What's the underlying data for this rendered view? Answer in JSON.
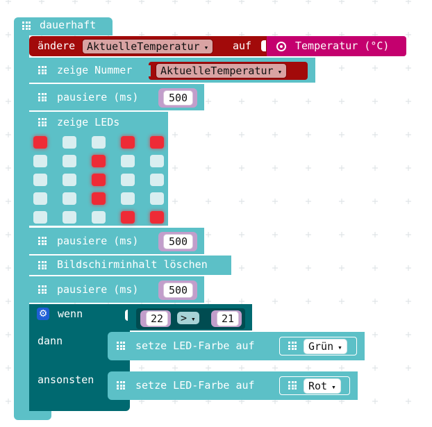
{
  "colors": {
    "basic": "#5cc0c7",
    "basic_dark": "#44a8ae",
    "variables": "#a20a0a",
    "variables_dark": "#7c0606",
    "input": "#c4006e",
    "logic": "#006970",
    "logic_dark": "#004c51",
    "math": "#c29ecb",
    "led": "#ee2b36",
    "led_off": "#d9eef0"
  },
  "blocks": {
    "forever": {
      "label": "dauerhaft"
    },
    "set_var": {
      "label": "ändere",
      "variable": "AktuelleTemperatur",
      "to_label": "auf",
      "sensor_label": "Temperatur (°C)",
      "sensor_icon": "thermometer-target-icon"
    },
    "show_number": {
      "label": "zeige Nummer",
      "variable": "AktuelleTemperatur"
    },
    "pause_1": {
      "label": "pausiere (ms)",
      "value": "500"
    },
    "show_leds": {
      "label": "zeige LEDs",
      "grid": [
        [
          1,
          0,
          0,
          1,
          1
        ],
        [
          0,
          0,
          1,
          0,
          0
        ],
        [
          0,
          0,
          1,
          0,
          0
        ],
        [
          0,
          0,
          1,
          0,
          0
        ],
        [
          0,
          0,
          0,
          1,
          1
        ]
      ]
    },
    "pause_2": {
      "label": "pausiere (ms)",
      "value": "500"
    },
    "clear_screen": {
      "label": "Bildschirminhalt löschen"
    },
    "pause_3": {
      "label": "pausiere (ms)",
      "value": "500"
    },
    "if_else": {
      "if_label": "wenn",
      "then_label": "dann",
      "else_label": "ansonsten",
      "gear_icon": "gear-icon",
      "compare": {
        "left": "22",
        "operator": ">",
        "right": "21"
      },
      "then_block": {
        "label": "setze LED-Farbe auf",
        "color": "Grün"
      },
      "else_block": {
        "label": "setze LED-Farbe auf",
        "color": "Rot"
      }
    }
  }
}
